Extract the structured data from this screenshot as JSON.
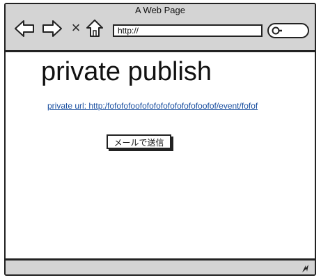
{
  "window": {
    "title": "A Web Page"
  },
  "toolbar": {
    "back_icon": "left-arrow-icon",
    "forward_icon": "right-arrow-icon",
    "stop_label": "×",
    "home_icon": "home-icon",
    "search_icon": "magnifier-icon"
  },
  "url_bar": {
    "value": "http://"
  },
  "page": {
    "heading": "private publish",
    "private_url_link": "private url: http:/fofofofoofofofofofofofofofoofof/event/fofof",
    "mail_button_label": "メールで送信"
  },
  "statusbar": {
    "grip_icon": "resize-grip-icon"
  },
  "colors": {
    "chrome_gray": "#d4d4d4",
    "border": "#222222",
    "link": "#1a4fa0",
    "background": "#ffffff"
  }
}
